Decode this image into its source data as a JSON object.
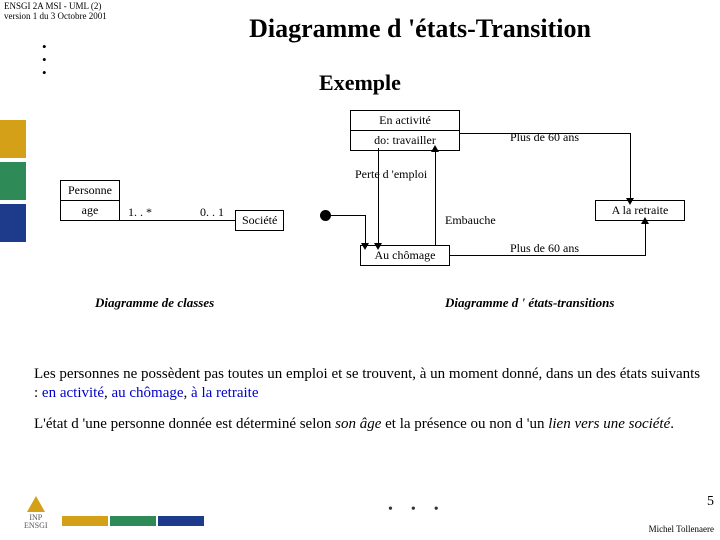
{
  "meta": {
    "line1": "ENSGI 2A MSI - UML (2)",
    "line2": "version 1 du 3 Octobre 2001"
  },
  "title": "Diagramme d 'états-Transition",
  "subtitle": "Exemple",
  "class_diagram": {
    "personne": {
      "name": "Personne",
      "attr": "age"
    },
    "societe": "Société",
    "mult_left": "1. . *",
    "mult_right": "0. . 1"
  },
  "states": {
    "activite": {
      "name": "En activité",
      "do": "do: travailler"
    },
    "chomage": "Au chômage",
    "retraite": "A la retraite"
  },
  "transitions": {
    "perte": "Perte d 'emploi",
    "embauche": "Embauche",
    "plus60_top": "Plus de 60 ans",
    "plus60_bot": "Plus de 60 ans"
  },
  "captions": {
    "classes": "Diagramme de classes",
    "states": "Diagramme d ' états-transitions"
  },
  "paragraphs": {
    "p1_a": "Les personnes ne possèdent pas toutes un emploi et se trouvent, à un moment donné, dans un des états suivants : ",
    "p1_b": "en activité",
    "p1_c": ", ",
    "p1_d": "au chômage",
    "p1_e": ", ",
    "p1_f": "à la retraite",
    "p2_a": "L'état d 'une personne donnée est déterminé selon ",
    "p2_b": "son âge",
    "p2_c": " et la présence ou non d 'un ",
    "p2_d": "lien vers une société",
    "p2_e": "."
  },
  "footer": {
    "page": "5",
    "author": "Michel Tollenaere"
  }
}
